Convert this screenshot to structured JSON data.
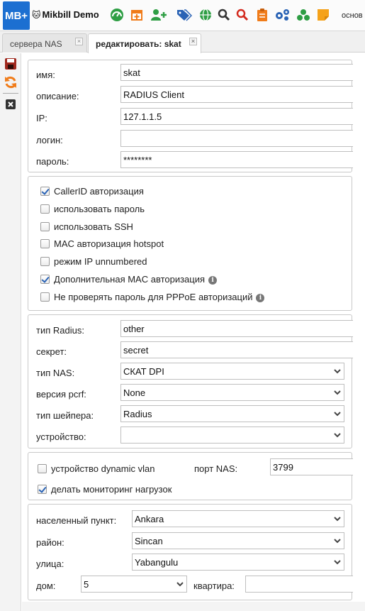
{
  "app": {
    "logo": "MB+",
    "title": "Mikbill Demo",
    "menu_partial": "основ"
  },
  "toolbar_icons": [
    "dashboard-icon",
    "calendar-add-icon",
    "add-user-icon",
    "tags-icon",
    "globe-icon",
    "search-icon",
    "search-red-icon",
    "clipboard-icon",
    "settings-icon",
    "network-icon",
    "note-icon"
  ],
  "tabs": [
    {
      "label": "сервера NAS",
      "active": false
    },
    {
      "label": "редактировать: skat",
      "active": true
    }
  ],
  "side_actions": [
    "save-icon",
    "refresh-icon",
    "close-icon"
  ],
  "general": {
    "name_label": "имя:",
    "name_value": "skat",
    "desc_label": "описание:",
    "desc_value": "RADIUS Client",
    "ip_label": "IP:",
    "ip_value": "127.1.1.5",
    "login_label": "логин:",
    "login_value": "",
    "password_label": "пароль:",
    "password_value": "********"
  },
  "options": [
    {
      "label": "CallerID авторизация",
      "checked": true,
      "info": false
    },
    {
      "label": "использовать пароль",
      "checked": false,
      "info": false
    },
    {
      "label": "использовать SSH",
      "checked": false,
      "info": false
    },
    {
      "label": "MAC авторизация hotspot",
      "checked": false,
      "info": false
    },
    {
      "label": "режим IP unnumbered",
      "checked": false,
      "info": false
    },
    {
      "label": "Дополнительная MAC авторизация",
      "checked": true,
      "info": true
    },
    {
      "label": "Не проверять пароль для PPPoE авторизаций",
      "checked": false,
      "info": true
    }
  ],
  "radius": {
    "radius_type_label": "тип Radius:",
    "radius_type_value": "other",
    "secret_label": "секрет:",
    "secret_value": "secret",
    "nas_type_label": "тип NAS:",
    "nas_type_value": "СКАТ DPI",
    "pcrf_label": "версия pcrf:",
    "pcrf_value": "None",
    "shaper_label": "тип шейпера:",
    "shaper_value": "Radius",
    "device_label": "устройство:",
    "device_value": ""
  },
  "vlan": {
    "dynamic_vlan_label": "устройство dynamic vlan",
    "dynamic_vlan_checked": false,
    "nas_port_label": "порт NAS:",
    "nas_port_value": "3799",
    "monitoring_label": "делать мониторинг нагрузок",
    "monitoring_checked": true
  },
  "address": {
    "city_label": "населенный пункт:",
    "city_value": "Ankara",
    "district_label": "район:",
    "district_value": "Sincan",
    "street_label": "улица:",
    "street_value": "Yabangulu",
    "house_label": "дом:",
    "house_value": "5",
    "apartment_label": "квартира:",
    "apartment_value": ""
  },
  "colors": {
    "logo_bg": "#1c6fd1",
    "save": "#a0281e",
    "refresh": "#f07c1a",
    "green": "#2e9e44",
    "blue": "#2a63b5",
    "red": "#d32a1e"
  }
}
